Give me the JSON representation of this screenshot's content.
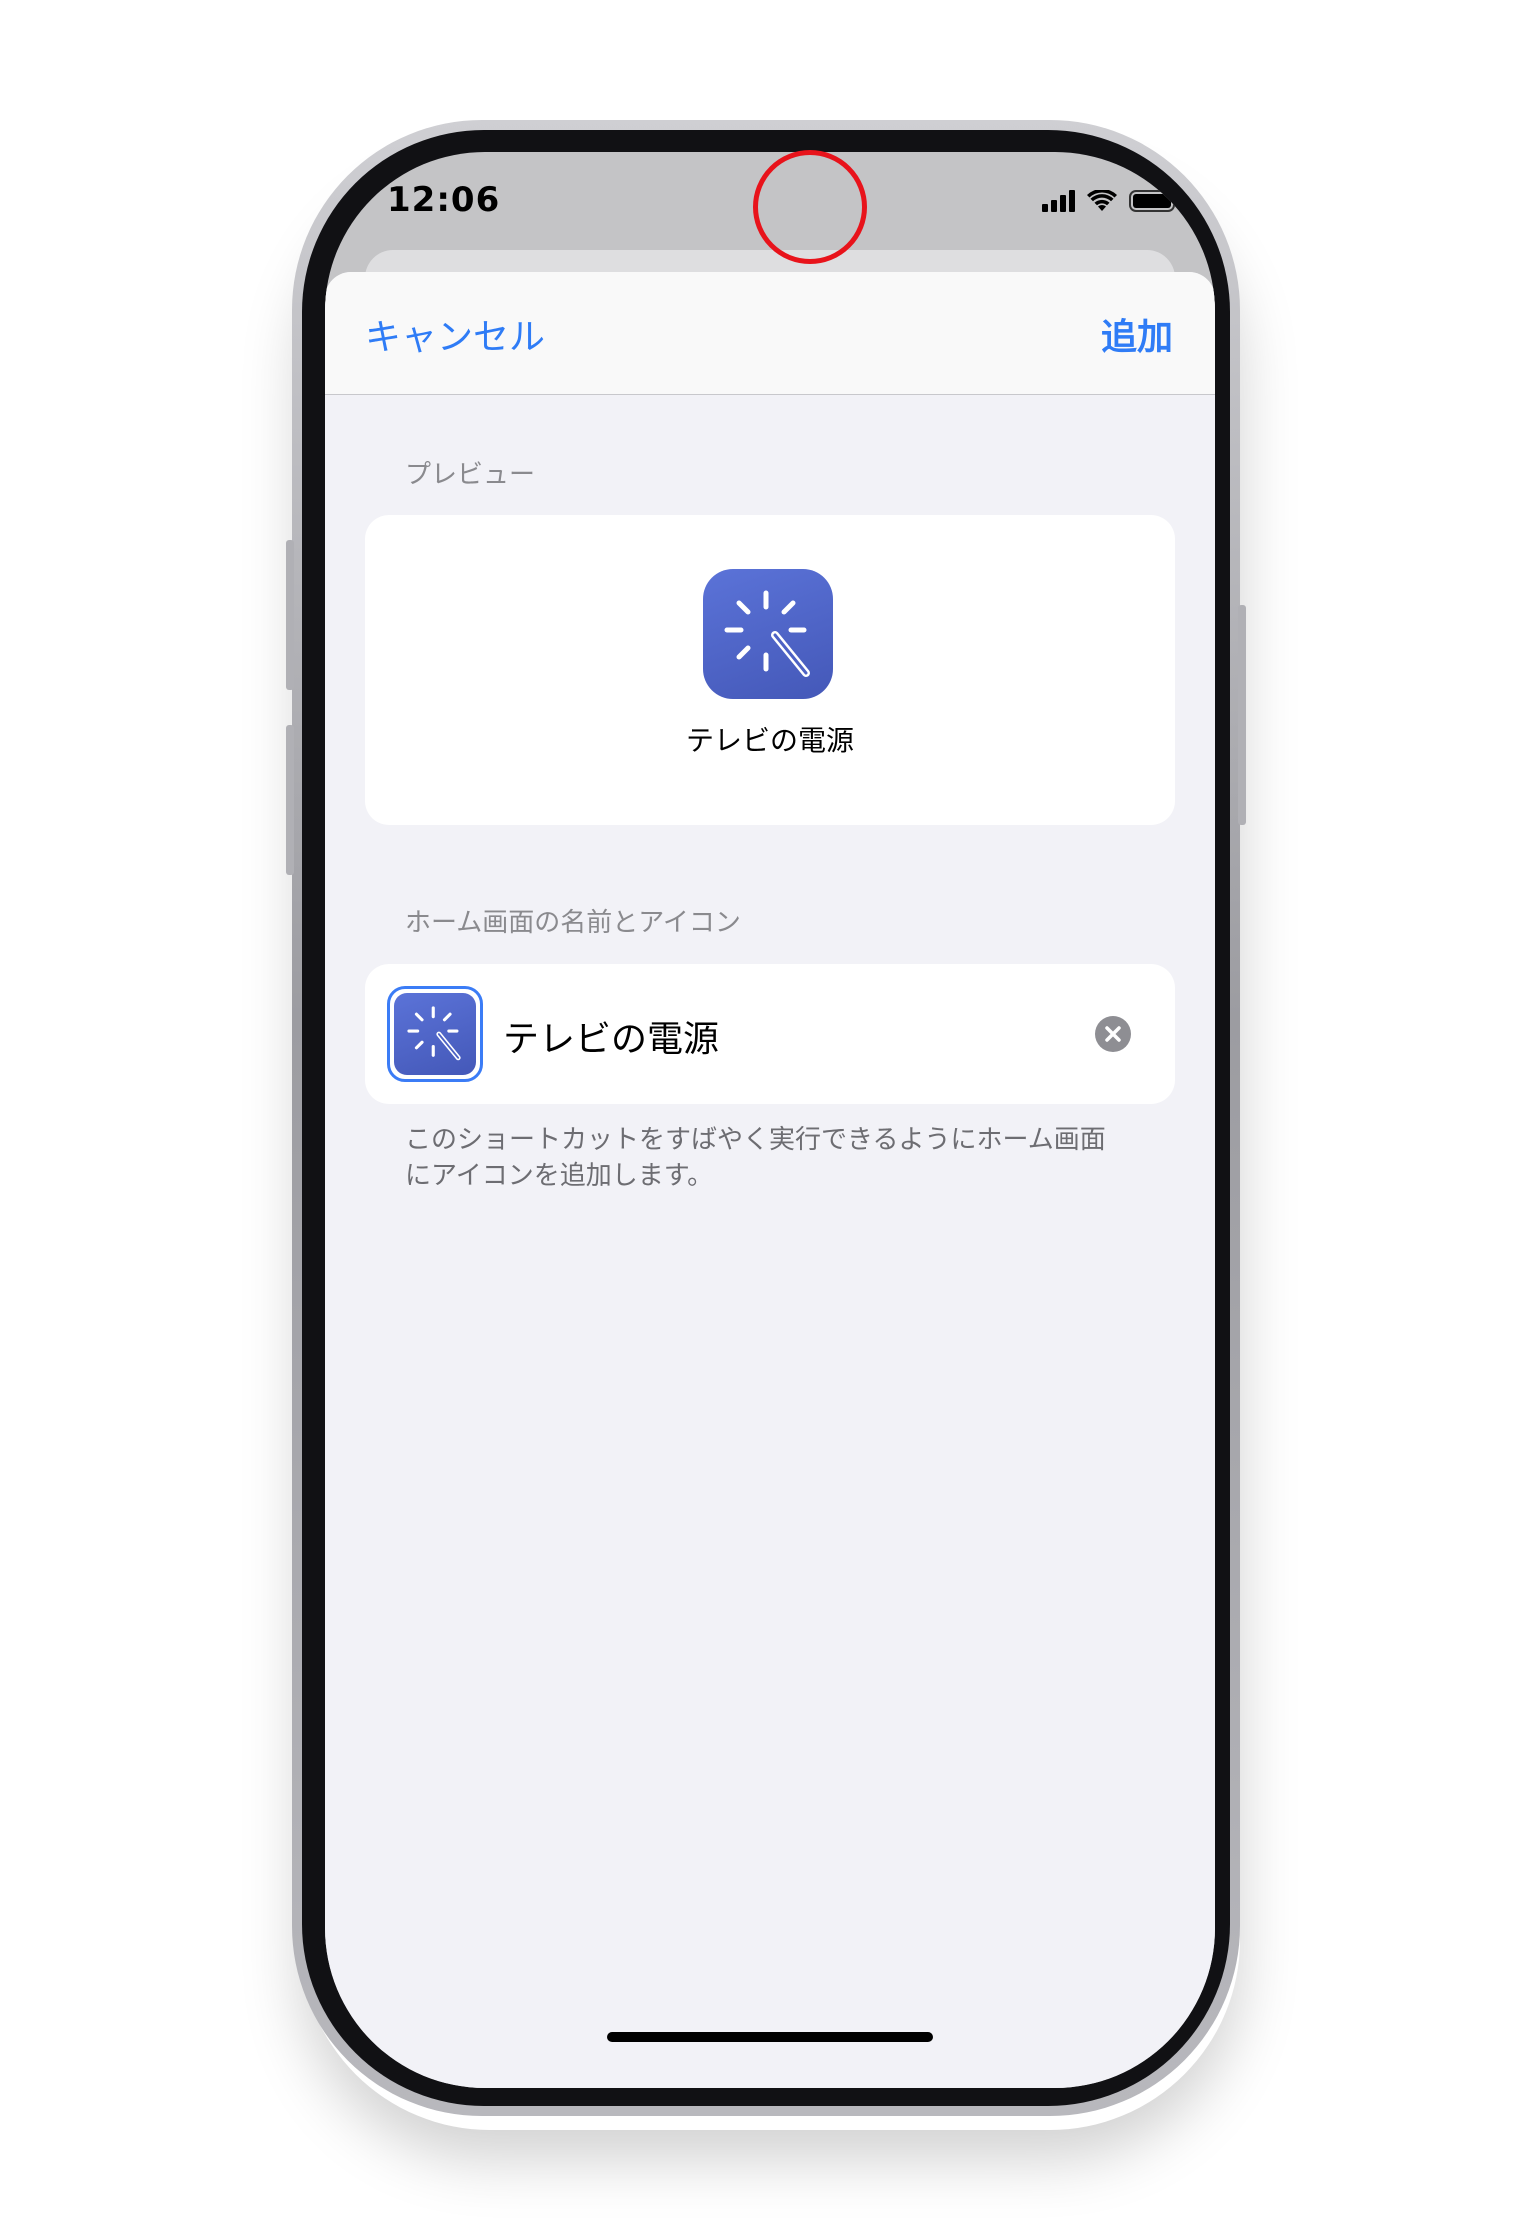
{
  "status_bar": {
    "time": "12:06"
  },
  "nav": {
    "cancel_label": "キャンセル",
    "add_label": "追加"
  },
  "preview": {
    "section_label": "プレビュー",
    "shortcut_name": "テレビの電源",
    "icon": "magic-wand-icon"
  },
  "home_screen": {
    "section_label": "ホーム画面の名前とアイコン",
    "name_value": "テレビの電源",
    "icon": "magic-wand-icon",
    "footnote_line1": "このショートカットをすばやく実行できるようにホーム画面",
    "footnote_line2": "にアイコンを追加します。"
  },
  "colors": {
    "accent": "#2f7cf6",
    "icon_background": "#4f66c8",
    "highlight": "#e8131b",
    "sheet_background": "#f2f2f7"
  }
}
